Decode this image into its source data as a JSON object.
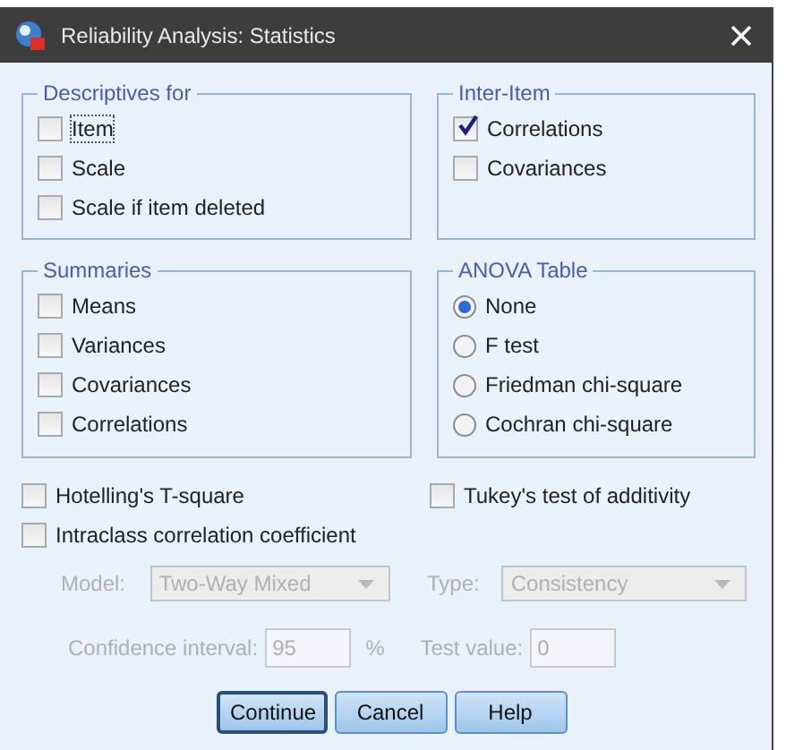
{
  "window": {
    "title": "Reliability Analysis: Statistics"
  },
  "groups": [
    {
      "title": "Descriptives for",
      "kind": "check",
      "items": [
        {
          "label": "Item",
          "checked": false,
          "focused": true
        },
        {
          "label": "Scale",
          "checked": false,
          "focused": false
        },
        {
          "label": "Scale if item deleted",
          "checked": false,
          "focused": false
        }
      ]
    },
    {
      "title": "Inter-Item",
      "kind": "check",
      "items": [
        {
          "label": "Correlations",
          "checked": true,
          "focused": false
        },
        {
          "label": "Covariances",
          "checked": false,
          "focused": false
        }
      ]
    },
    {
      "title": "Summaries",
      "kind": "check",
      "items": [
        {
          "label": "Means",
          "checked": false,
          "focused": false
        },
        {
          "label": "Variances",
          "checked": false,
          "focused": false
        },
        {
          "label": "Covariances",
          "checked": false,
          "focused": false
        },
        {
          "label": "Correlations",
          "checked": false,
          "focused": false
        }
      ]
    },
    {
      "title": "ANOVA Table",
      "kind": "radio",
      "items": [
        {
          "label": "None",
          "selected": true
        },
        {
          "label": "F test",
          "selected": false
        },
        {
          "label": "Friedman chi-square",
          "selected": false
        },
        {
          "label": "Cochran chi-square",
          "selected": false
        }
      ]
    }
  ],
  "options": [
    {
      "label": "Hotelling's T-square",
      "checked": false
    },
    {
      "label": "Tukey's test of additivity",
      "checked": false
    },
    {
      "label": "Intraclass correlation coefficient",
      "checked": false
    }
  ],
  "icc": {
    "disabled": true,
    "model": {
      "label": "Model:",
      "value": "Two-Way Mixed"
    },
    "type": {
      "label": "Type:",
      "value": "Consistency"
    },
    "confidence": {
      "label": "Confidence interval:",
      "value": "95",
      "unit": "%"
    },
    "test_value": {
      "label": "Test value:",
      "value": "0"
    }
  },
  "buttons": [
    {
      "label": "Continue",
      "default": true
    },
    {
      "label": "Cancel",
      "default": false
    },
    {
      "label": "Help",
      "default": false
    }
  ]
}
